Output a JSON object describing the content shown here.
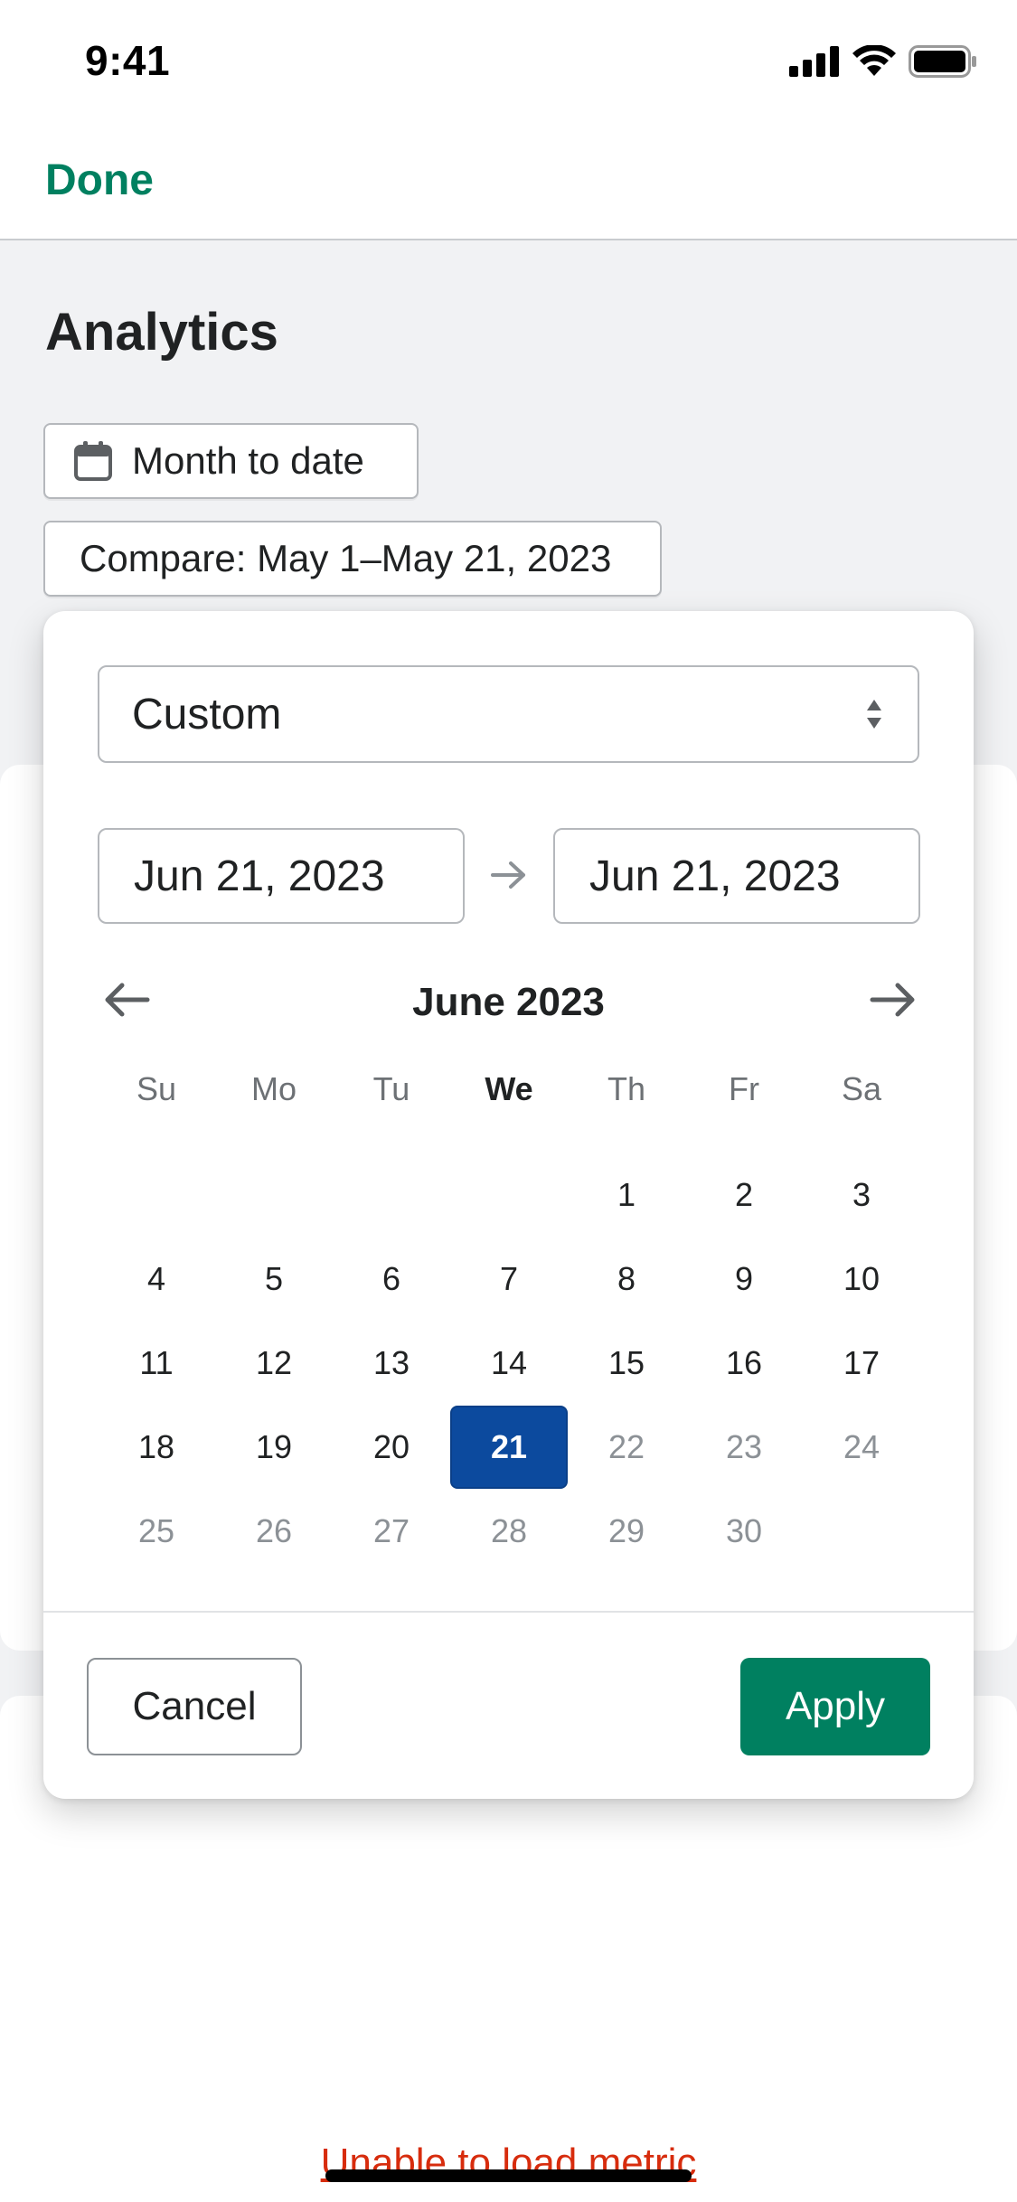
{
  "status_bar": {
    "time": "9:41"
  },
  "nav": {
    "done_label": "Done"
  },
  "page": {
    "title": "Analytics"
  },
  "filters": {
    "date_range_label": "Month to date",
    "compare_label": "Compare: May 1–May 21, 2023"
  },
  "picker": {
    "preset_value": "Custom",
    "start_date": "Jun 21, 2023",
    "end_date": "Jun 21, 2023",
    "month_title": "June 2023",
    "weekdays": [
      "Su",
      "Mo",
      "Tu",
      "We",
      "Th",
      "Fr",
      "Sa"
    ],
    "today_weekday_index": 3,
    "weeks": [
      [
        "",
        "",
        "",
        "",
        "1",
        "2",
        "3"
      ],
      [
        "4",
        "5",
        "6",
        "7",
        "8",
        "9",
        "10"
      ],
      [
        "11",
        "12",
        "13",
        "14",
        "15",
        "16",
        "17"
      ],
      [
        "18",
        "19",
        "20",
        "21",
        "22",
        "23",
        "24"
      ],
      [
        "25",
        "26",
        "27",
        "28",
        "29",
        "30",
        ""
      ]
    ],
    "selected_day": "21",
    "disabled_after_day": 21,
    "cancel_label": "Cancel",
    "apply_label": "Apply"
  },
  "background": {
    "error_text": "Unable to load metric"
  },
  "colors": {
    "accent": "#008060",
    "selected_day": "#0c4a9e",
    "error": "#d72c0d"
  }
}
